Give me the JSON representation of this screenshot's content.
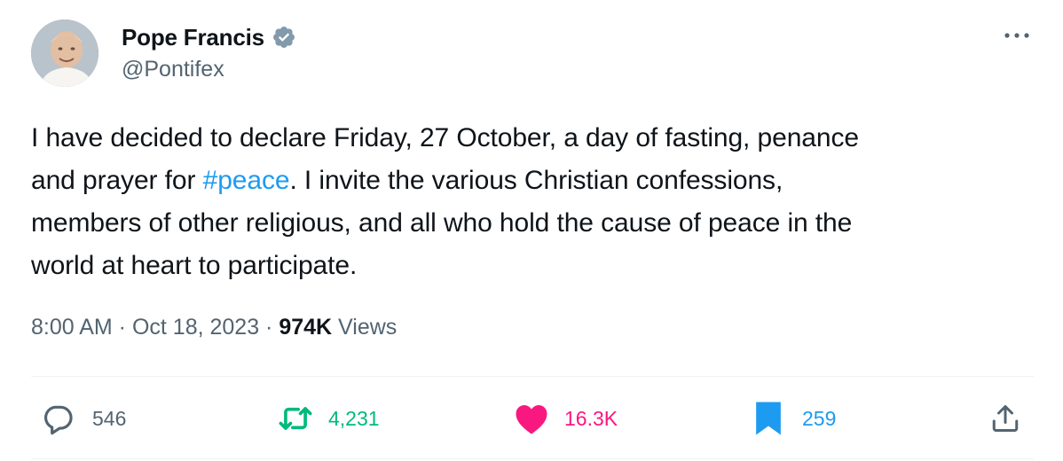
{
  "author": {
    "display_name": "Pope Francis",
    "handle": "@Pontifex",
    "verified": true,
    "verified_badge_icon": "verified-badge-icon"
  },
  "tweet": {
    "lines": [
      "I have decided to declare Friday, 27 October, a day of fasting, penance",
      {
        "before": "and prayer for ",
        "hashtag": "#peace",
        "after": ". I invite the various Christian confessions,"
      },
      "members of other religious, and all who hold the cause of peace in the",
      "world at heart to participate."
    ]
  },
  "meta": {
    "time": "8:00 AM",
    "separator1": " · ",
    "date": "Oct 18, 2023",
    "separator2": " · ",
    "views_count": "974K",
    "views_label": " Views"
  },
  "actions": {
    "reply": {
      "icon": "reply-icon",
      "count": "546"
    },
    "retweet": {
      "icon": "retweet-icon",
      "count": "4,231",
      "color": "#00ba7c"
    },
    "like": {
      "icon": "heart-icon",
      "count": "16.3K",
      "color": "#f91880"
    },
    "bookmark": {
      "icon": "bookmark-icon",
      "count": "259",
      "color": "#1d9bf0"
    },
    "share": {
      "icon": "share-icon"
    }
  },
  "colors": {
    "text_primary": "#0f1419",
    "text_secondary": "#536471",
    "link": "#1d9bf0",
    "verified": "#829aab"
  }
}
